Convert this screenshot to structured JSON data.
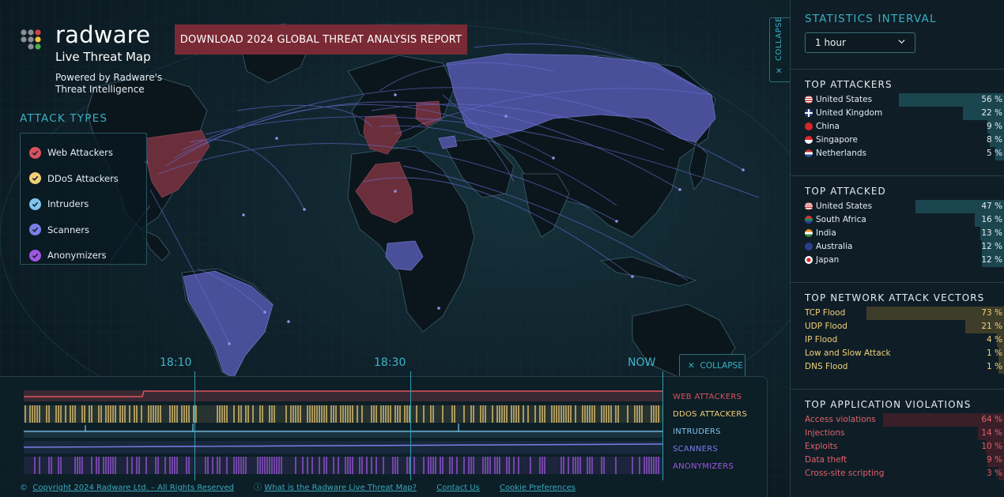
{
  "brand": {
    "name": "radware",
    "product": "Live Threat Map",
    "powered_by": "Powered by Radware's Threat Intelligence",
    "download_label": "DOWNLOAD 2024 GLOBAL THREAT ANALYSIS REPORT"
  },
  "attack_types": {
    "title": "ATTACK TYPES",
    "items": [
      {
        "label": "Web Attackers",
        "color": "#d9525f",
        "icon": "check-icon"
      },
      {
        "label": "DDoS Attackers",
        "color": "#f2d078",
        "icon": "check-icon"
      },
      {
        "label": "Intruders",
        "color": "#7fc4ee",
        "icon": "check-icon"
      },
      {
        "label": "Scanners",
        "color": "#7a7ee8",
        "icon": "check-icon"
      },
      {
        "label": "Anonymizers",
        "color": "#9f58e0",
        "icon": "check-icon"
      }
    ]
  },
  "collapse": {
    "panel_label": "COLLAPSE",
    "timeline_label": "COLLAPSE",
    "close_icon": "close-icon"
  },
  "stats": {
    "interval_title": "STATISTICS INTERVAL",
    "interval_value": "1 hour",
    "top_attackers": {
      "title": "TOP ATTACKERS",
      "color": "#1b4650",
      "rows": [
        {
          "name": "United States",
          "pct": "56 %",
          "value": 56,
          "flag": "us"
        },
        {
          "name": "United Kingdom",
          "pct": "22 %",
          "value": 22,
          "flag": "uk"
        },
        {
          "name": "China",
          "pct": "9 %",
          "value": 9,
          "flag": "cn"
        },
        {
          "name": "Singapore",
          "pct": "8 %",
          "value": 8,
          "flag": "sg"
        },
        {
          "name": "Netherlands",
          "pct": "5 %",
          "value": 5,
          "flag": "nl"
        }
      ]
    },
    "top_attacked": {
      "title": "TOP ATTACKED",
      "color": "#1b4650",
      "rows": [
        {
          "name": "United States",
          "pct": "47 %",
          "value": 47,
          "flag": "us"
        },
        {
          "name": "South Africa",
          "pct": "16 %",
          "value": 16,
          "flag": "za"
        },
        {
          "name": "India",
          "pct": "13 %",
          "value": 13,
          "flag": "in"
        },
        {
          "name": "Australia",
          "pct": "12 %",
          "value": 12,
          "flag": "au"
        },
        {
          "name": "Japan",
          "pct": "12 %",
          "value": 12,
          "flag": "jp"
        }
      ]
    },
    "network_vectors": {
      "title": "TOP NETWORK ATTACK VECTORS",
      "text_color": "#f2d078",
      "color": "#3e3d2a",
      "rows": [
        {
          "name": "TCP Flood",
          "pct": "73 %",
          "value": 73
        },
        {
          "name": "UDP Flood",
          "pct": "21 %",
          "value": 21
        },
        {
          "name": "IP Flood",
          "pct": "4 %",
          "value": 4
        },
        {
          "name": "Low and Slow Attack",
          "pct": "1 %",
          "value": 1
        },
        {
          "name": "DNS Flood",
          "pct": "1 %",
          "value": 1
        }
      ]
    },
    "app_violations": {
      "title": "TOP APPLICATION VIOLATIONS",
      "text_color": "#e0606c",
      "color": "#3a1f28",
      "rows": [
        {
          "name": "Access violations",
          "pct": "64 %",
          "value": 64
        },
        {
          "name": "Injections",
          "pct": "14 %",
          "value": 14
        },
        {
          "name": "Exploits",
          "pct": "10 %",
          "value": 10
        },
        {
          "name": "Data theft",
          "pct": "9 %",
          "value": 9
        },
        {
          "name": "Cross-site scripting",
          "pct": "3 %",
          "value": 3
        }
      ]
    }
  },
  "timeline": {
    "times": [
      "18:10",
      "18:30",
      "NOW"
    ],
    "series": [
      {
        "label": "WEB ATTACKERS",
        "color": "#d9525f"
      },
      {
        "label": "DDOS ATTACKERS",
        "color": "#f2d078"
      },
      {
        "label": "INTRUDERS",
        "color": "#7fc4ee"
      },
      {
        "label": "SCANNERS",
        "color": "#7a7ee8"
      },
      {
        "label": "ANONYMIZERS",
        "color": "#9f58e0"
      }
    ]
  },
  "footer": {
    "copyright_symbol": "©",
    "copyright": "Copyright 2024 Radware Ltd. – All Rights Reserved",
    "info_icon": "info-icon",
    "what_is": "What is the Radware Live Threat Map?",
    "contact": "Contact Us",
    "cookies": "Cookie Preferences"
  }
}
